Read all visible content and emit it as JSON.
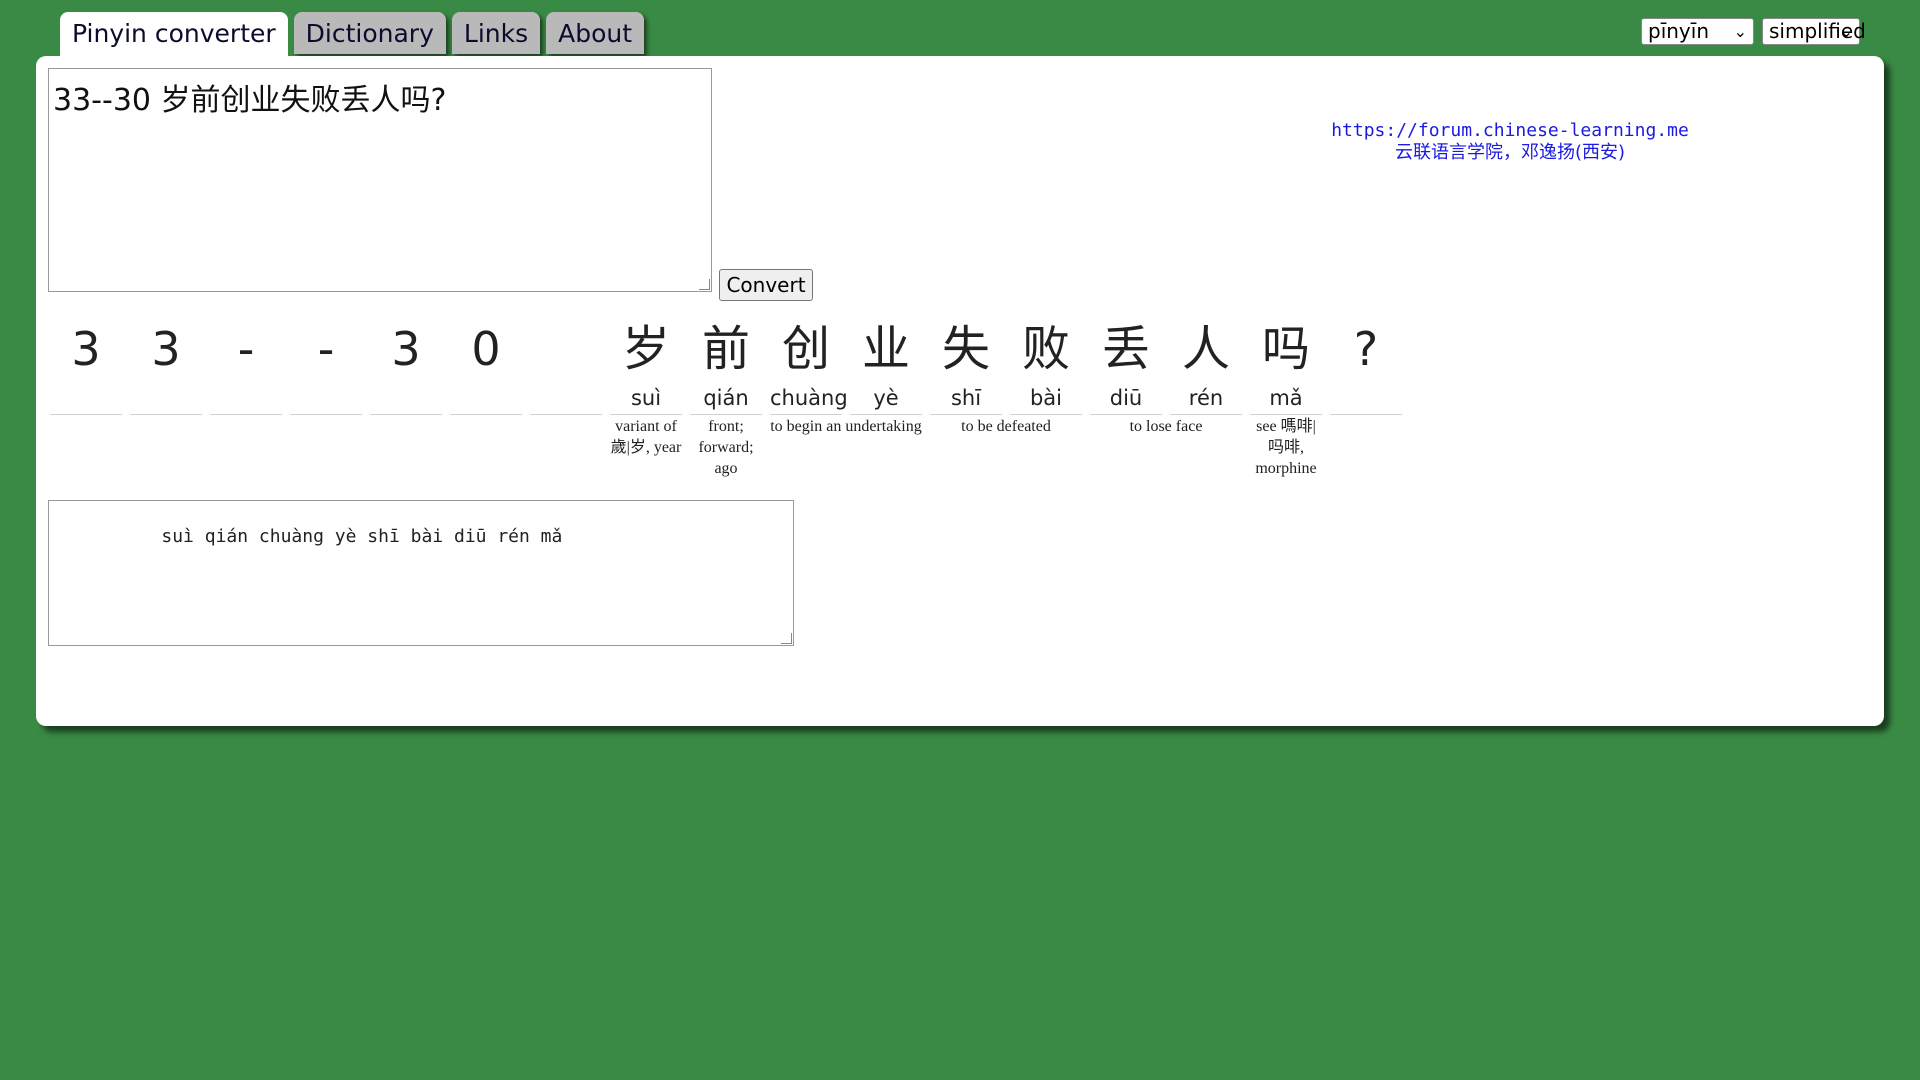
{
  "tabs": [
    {
      "label": "Pinyin converter",
      "active": true
    },
    {
      "label": "Dictionary",
      "active": false
    },
    {
      "label": "Links",
      "active": false
    },
    {
      "label": "About",
      "active": false
    }
  ],
  "selects": {
    "tone_style": "pīnyīn",
    "script": "simplified"
  },
  "input": {
    "text": "33--30 岁前创业失败丢人吗?"
  },
  "convert_label": "Convert",
  "info": {
    "url": "https://forum.chinese-learning.me",
    "credit": "云联语言学院，邓逸扬(西安)"
  },
  "tokens": [
    {
      "char": "3",
      "pinyin": ""
    },
    {
      "char": "3",
      "pinyin": ""
    },
    {
      "char": "-",
      "pinyin": ""
    },
    {
      "char": "-",
      "pinyin": ""
    },
    {
      "char": "3",
      "pinyin": ""
    },
    {
      "char": "0",
      "pinyin": ""
    },
    {
      "char": "",
      "pinyin": ""
    },
    {
      "char": "岁",
      "pinyin": "suì"
    },
    {
      "char": "前",
      "pinyin": "qián"
    },
    {
      "char": "创",
      "pinyin": "chuàng"
    },
    {
      "char": "业",
      "pinyin": "yè"
    },
    {
      "char": "失",
      "pinyin": "shī"
    },
    {
      "char": "败",
      "pinyin": "bài"
    },
    {
      "char": "丢",
      "pinyin": "diū"
    },
    {
      "char": "人",
      "pinyin": "rén"
    },
    {
      "char": "吗",
      "pinyin": "mǎ"
    },
    {
      "char": "?",
      "pinyin": ""
    }
  ],
  "glosses": [
    {
      "text": "variant of 歲|岁, year"
    },
    {
      "text": "front; forward; ago"
    },
    {
      "text": "to begin an undertaking"
    },
    {
      "text": "to be defeated"
    },
    {
      "text": "to lose face"
    },
    {
      "text": "see 嗎啡|吗啡, morphine"
    }
  ],
  "output": {
    "text": "      suì qián chuàng yè shī bài diū rén mǎ"
  },
  "colors": {
    "background": "#398a44",
    "link": "#1a1ae0"
  }
}
